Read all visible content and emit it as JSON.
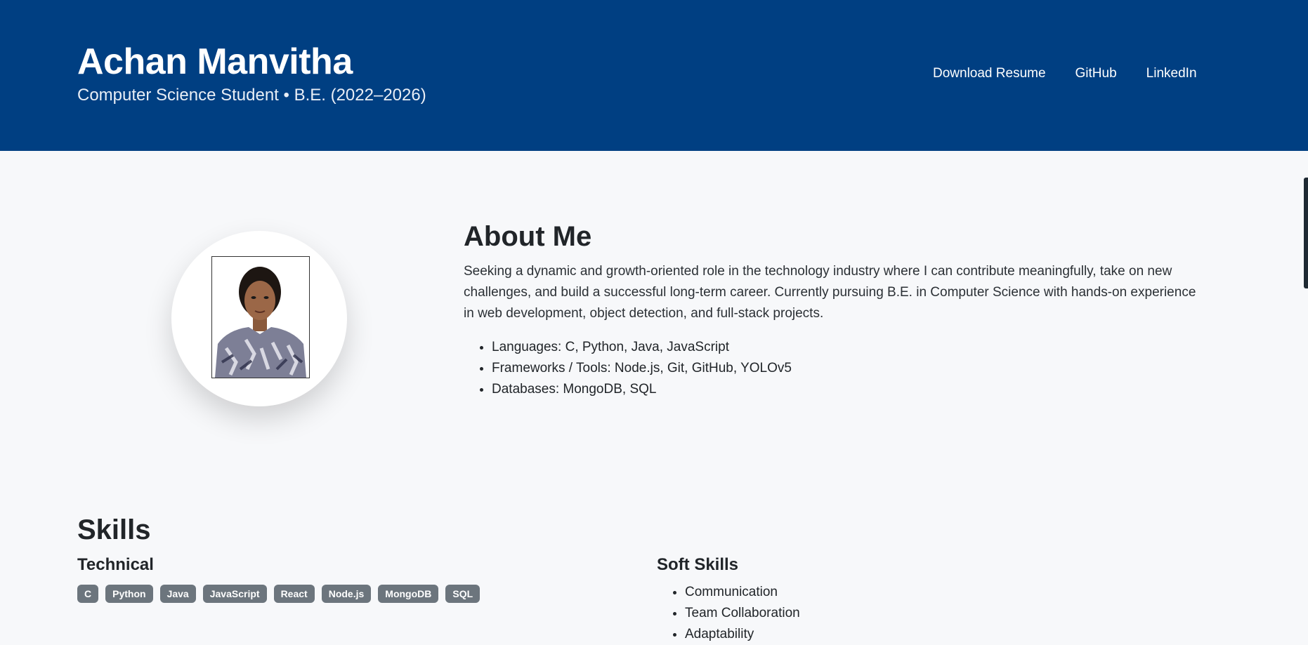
{
  "header": {
    "name": "Achan Manvitha",
    "subtitle": "Computer Science Student • B.E. (2022–2026)",
    "nav": [
      "Download Resume",
      "GitHub",
      "LinkedIn"
    ],
    "bg_color": "#003f82"
  },
  "about": {
    "title": "About Me",
    "paragraph": "Seeking a dynamic and growth-oriented role in the technology industry where I can contribute meaningfully, take on new challenges, and build a successful long-term career. Currently pursuing B.E. in Computer Science with hands-on experience in web development, object detection, and full-stack projects.",
    "items": [
      "Languages: C, Python, Java, JavaScript",
      "Frameworks / Tools: Node.js, Git, GitHub, YOLOv5",
      "Databases: MongoDB, SQL"
    ]
  },
  "skills": {
    "title": "Skills",
    "technical_title": "Technical",
    "technical": [
      "C",
      "Python",
      "Java",
      "JavaScript",
      "React",
      "Node.js",
      "MongoDB",
      "SQL"
    ],
    "soft_title": "Soft Skills",
    "soft": [
      "Communication",
      "Team Collaboration",
      "Adaptability"
    ]
  }
}
